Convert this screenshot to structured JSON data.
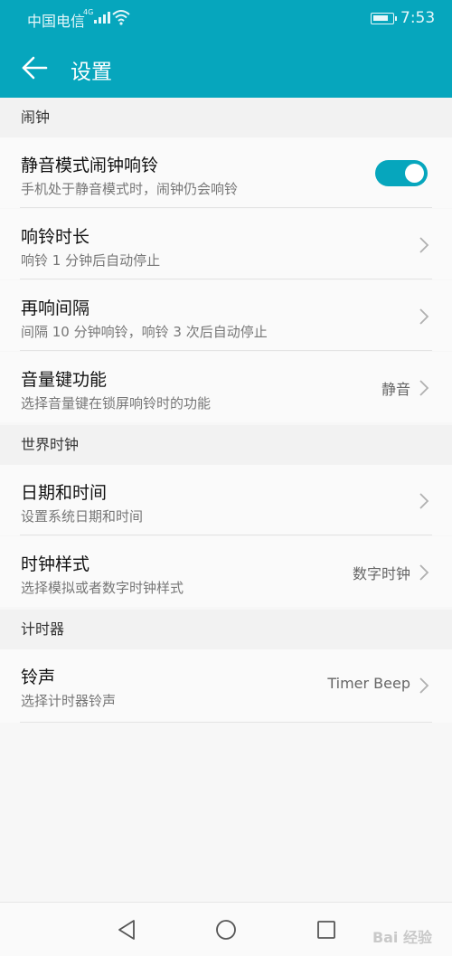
{
  "status": {
    "carrier": "中国电信",
    "network": "4G",
    "time": "7:53"
  },
  "header": {
    "title": "设置"
  },
  "sections": {
    "alarm": {
      "label": "闹钟",
      "items": [
        {
          "title": "静音模式闹钟响铃",
          "subtitle": "手机处于静音模式时，闹钟仍会响铃",
          "toggle_on": true
        },
        {
          "title": "响铃时长",
          "subtitle": "响铃 1 分钟后自动停止"
        },
        {
          "title": "再响间隔",
          "subtitle": "间隔 10 分钟响铃，响铃 3 次后自动停止"
        },
        {
          "title": "音量键功能",
          "subtitle": "选择音量键在锁屏响铃时的功能",
          "value": "静音"
        }
      ]
    },
    "world_clock": {
      "label": "世界时钟",
      "items": [
        {
          "title": "日期和时间",
          "subtitle": "设置系统日期和时间"
        },
        {
          "title": "时钟样式",
          "subtitle": "选择模拟或者数字时钟样式",
          "value": "数字时钟"
        }
      ]
    },
    "timer": {
      "label": "计时器",
      "items": [
        {
          "title": "铃声",
          "subtitle": "选择计时器铃声",
          "value": "Timer Beep"
        }
      ]
    }
  },
  "watermark": "Bai 经验",
  "colors": {
    "accent": "#06a6bd",
    "background": "#f7f7f7"
  },
  "icons": [
    "back-arrow-icon",
    "chevron-right-icon",
    "nav-back-icon",
    "nav-home-icon",
    "nav-recents-icon"
  ]
}
